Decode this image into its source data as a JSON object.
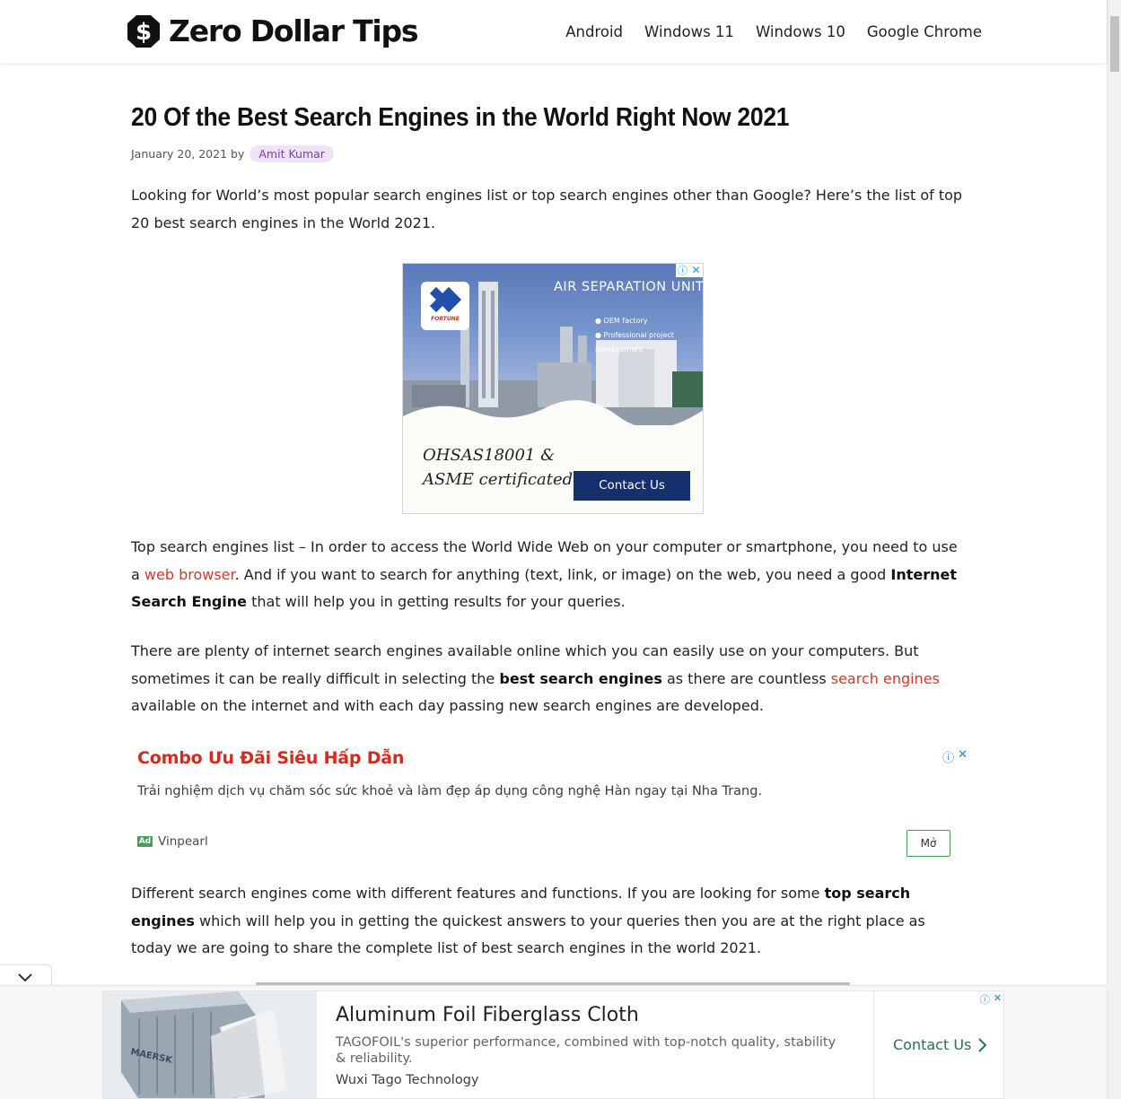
{
  "header": {
    "logo_text": "Zero Dollar Tips",
    "nav": [
      "Android",
      "Windows 11",
      "Windows 10",
      "Google Chrome"
    ]
  },
  "article": {
    "title": "20 Of the Best Search Engines in the World Right Now 2021",
    "date": "January 20, 2021",
    "by": "by",
    "author": "Amit Kumar",
    "intro": "Looking for World’s most popular search engines list or top search engines other than Google? Here’s the list of top 20 best search engines in the World 2021.",
    "p1_a": "Top search engines list – In order to access the World Wide Web on your computer or smartphone, you need to use a ",
    "p1_link": "web browser",
    "p1_b": ". And if you want to search for anything (text, link, or image) on the web, you need a good ",
    "p1_bold": "Internet Search Engine",
    "p1_c": " that will help you in getting results for your queries.",
    "p2_a": "There are plenty of internet search engines available online which you can easily use on your computers. But sometimes it can be really difficult in selecting the ",
    "p2_bold": "best search engines",
    "p2_b": " as there are countless ",
    "p2_link": "search engines",
    "p2_c": " available on the internet and with each day passing new search engines are developed.",
    "p3_a": "Different search engines come with different features and functions. If you are looking for some ",
    "p3_bold": "top search engines",
    "p3_b": " which will help you in getting the quickest answers to your queries then you are at the right place as today we are going to share the complete list of best search engines in the world 2021."
  },
  "ad1": {
    "headline": "AIR SEPARATION UNIT",
    "bullet1": "OEM factory",
    "bullet2": "Professional project management",
    "logo_text": "FORTUNE",
    "cert_line1": "OHSAS18001 &",
    "cert_line2": "ASME certificated",
    "cta": "Contact Us",
    "brand_color": "#16306e"
  },
  "ad2": {
    "headline": "Combo Ưu Đãi Siêu Hấp Dẫn",
    "description": "Trải nghiệm dịch vụ chăm sóc sức khoẻ và làm đẹp áp dụng công nghệ Hàn ngay tại Nha Trang.",
    "badge": "Ad",
    "advertiser": "Vinpearl",
    "cta": "Mở"
  },
  "bottom_ad": {
    "headline": "Aluminum Foil Fiberglass Cloth",
    "description": "TAGOFOIL's superior performance, combined with top-notch quality, stability & reliability.",
    "advertiser": "Wuxi Tago Technology",
    "cta": "Contact Us",
    "container_text": "MAERSK"
  },
  "colors": {
    "link": "#d23a2a",
    "author_bg": "#efe3f7",
    "author_text": "#7b3fa0",
    "ad_headline": "#d32b1e"
  }
}
